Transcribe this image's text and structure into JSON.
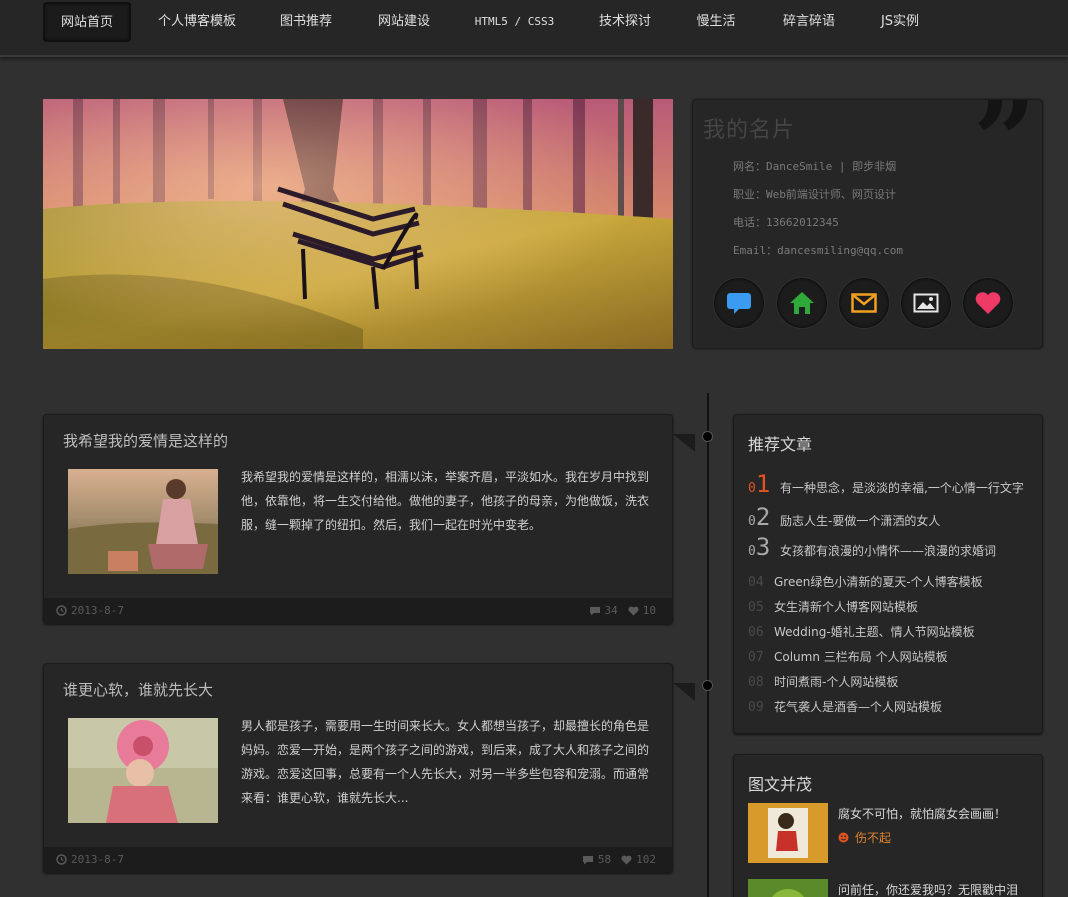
{
  "nav": {
    "items": [
      {
        "label": "网站首页"
      },
      {
        "label": "个人博客模板"
      },
      {
        "label": "图书推荐"
      },
      {
        "label": "网站建设"
      },
      {
        "label": "HTML5 / CSS3"
      },
      {
        "label": "技术探讨"
      },
      {
        "label": "慢生活"
      },
      {
        "label": "碎言碎语"
      },
      {
        "label": "JS实例"
      }
    ]
  },
  "card": {
    "title": "我的名片",
    "nickname": "网名：DanceSmile | 即步非烟",
    "job": "职业：Web前端设计师、网页设计",
    "phone": "电话：13662012345",
    "email": "Email：dancesmiling@qq.com",
    "icons": [
      "chat-icon",
      "home-icon",
      "mail-icon",
      "gallery-icon",
      "heart-icon"
    ],
    "icon_colors": [
      "#3a9bf0",
      "#2faa3a",
      "#f0a020",
      "#e6e6e6",
      "#f03a66"
    ]
  },
  "articles": [
    {
      "title": "我希望我的爱情是这样的",
      "text": "我希望我的爱情是这样的，相濡以沫，举案齐眉，平淡如水。我在岁月中找到他，依靠他，将一生交付给他。做他的妻子，他孩子的母亲，为他做饭，洗衣服，缝一颗掉了的纽扣。然后，我们一起在时光中变老。",
      "date": "2013-8-7",
      "comments": "34",
      "likes": "10"
    },
    {
      "title": "谁更心软，谁就先长大",
      "text": "男人都是孩子，需要用一生时间来长大。女人都想当孩子，却最擅长的角色是妈妈。恋爱一开始，是两个孩子之间的游戏，到后来，成了大人和孩子之间的游戏。恋爱这回事，总要有一个人先长大，对另一半多些包容和宠溺。而通常来看：谁更心软，谁就先长大...",
      "date": "2013-8-7",
      "comments": "58",
      "likes": "102"
    }
  ],
  "recommend": {
    "title": "推荐文章",
    "items": [
      {
        "num_prefix": "0",
        "num_main": "1",
        "label": "有一种思念，是淡淡的幸福,一个心情一行文字"
      },
      {
        "num_prefix": "0",
        "num_main": "2",
        "label": "励志人生-要做一个潇洒的女人"
      },
      {
        "num_prefix": "0",
        "num_main": "3",
        "label": "女孩都有浪漫的小情怀——浪漫的求婚词"
      },
      {
        "num": "04",
        "label": "Green绿色小清新的夏天-个人博客模板"
      },
      {
        "num": "05",
        "label": "女生清新个人博客网站模板"
      },
      {
        "num": "06",
        "label": "Wedding-婚礼主题、情人节网站模板"
      },
      {
        "num": "07",
        "label": "Column 三栏布局 个人网站模板"
      },
      {
        "num": "08",
        "label": "时间煮雨-个人网站模板"
      },
      {
        "num": "09",
        "label": "花气袭人是酒香—个人网站模板"
      }
    ]
  },
  "gallery": {
    "title": "图文并茂",
    "items": [
      {
        "title": "腐女不可怕，就怕腐女会画画！",
        "author": "伤不起"
      },
      {
        "title": "问前任，你还爱我吗？无限戳中泪"
      }
    ]
  },
  "colors": {
    "accent": "#e0521f",
    "background": "#303030",
    "panel": "#262626"
  }
}
